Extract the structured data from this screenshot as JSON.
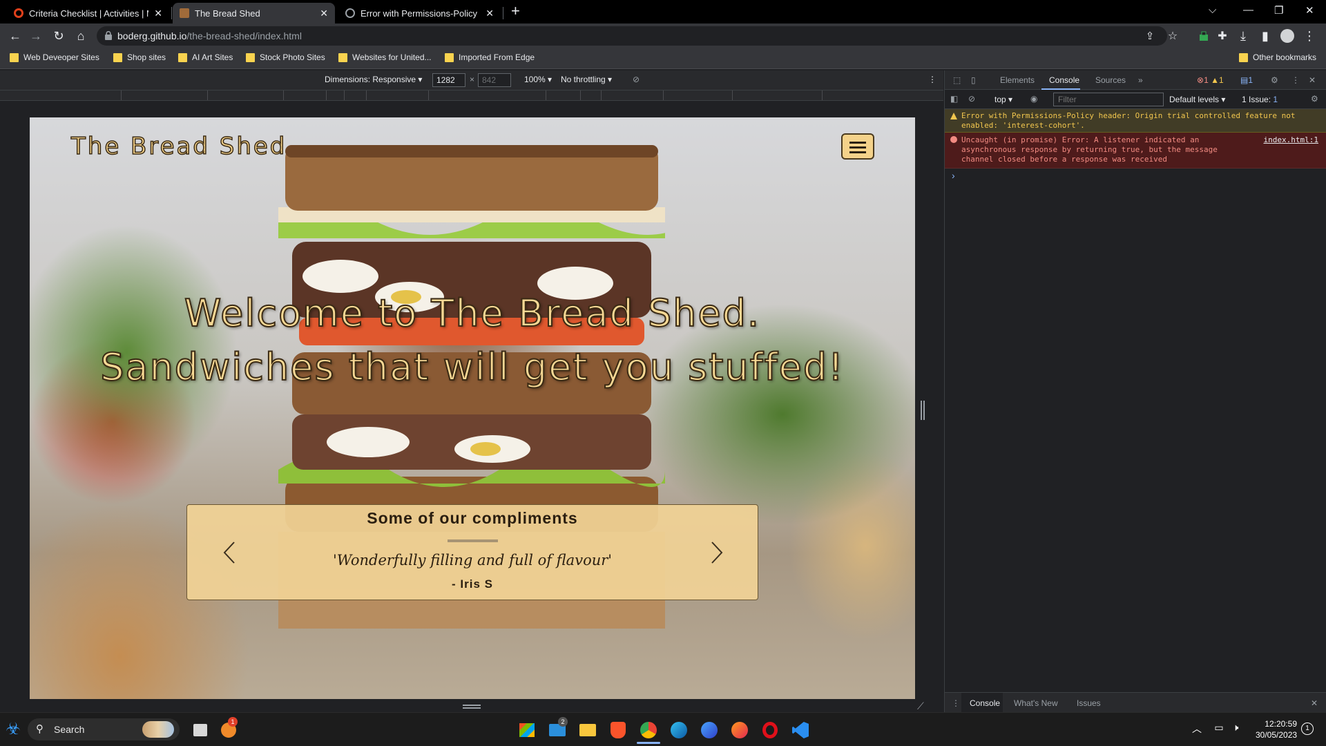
{
  "browser": {
    "tabs": [
      {
        "title": "Criteria Checklist | Activities | MS",
        "favicon_color": "#e0401b",
        "active": false
      },
      {
        "title": "The Bread Shed",
        "favicon_color": "#a06b3a",
        "active": true
      },
      {
        "title": "Error with Permissions-Policy hea",
        "favicon_color": "#9aa0a6",
        "active": false
      }
    ],
    "new_tab": "+",
    "url_host": "boderg.github.io",
    "url_path": "/the-bread-shed/index.html",
    "bookmarks": [
      "Web Deveoper Sites",
      "Shop sites",
      "AI Art Sites",
      "Stock Photo Sites",
      "Websites for United...",
      "Imported From Edge"
    ],
    "other_bookmarks": "Other bookmarks"
  },
  "device_toolbar": {
    "dimensions_label": "Dimensions: Responsive",
    "width": "1282",
    "height": "842",
    "times": "×",
    "zoom": "100%",
    "throttling": "No throttling"
  },
  "page": {
    "brand": "The Bread Shed",
    "hero_line1": "Welcome to The Bread Shed.",
    "hero_line2": "Sandwiches that will get you stuffed!",
    "compliments_title": "Some of our compliments",
    "quote": "'Wonderfully filling and full of flavour'",
    "author": "- Iris S"
  },
  "devtools": {
    "tabs": [
      "Elements",
      "Console",
      "Sources",
      "»"
    ],
    "active_tab": "Console",
    "error_count": "1",
    "warning_count": "1",
    "info_count": "1",
    "context": "top",
    "filter_placeholder": "Filter",
    "levels": "Default levels",
    "issues": "1 Issue:",
    "issues_count": "1",
    "warning_message": "Error with Permissions-Policy header: Origin trial controlled feature not enabled: 'interest-cohort'.",
    "error_message": "Uncaught (in promise) Error: A listener indicated an asynchronous response by returning true, but the message channel closed before a response was received",
    "error_source": "index.html:1",
    "prompt": "›",
    "drawer_tabs": [
      "Console",
      "What's New",
      "Issues"
    ]
  },
  "taskbar": {
    "search": "Search",
    "time": "12:20:59",
    "date": "30/05/2023",
    "notification_count": "1",
    "mail_badge": "2"
  },
  "colors": {
    "brand_gold": "#f4d28a",
    "error_red": "#f28b82",
    "warn_yellow": "#f2c64e",
    "accent_blue": "#8ab4f8"
  }
}
